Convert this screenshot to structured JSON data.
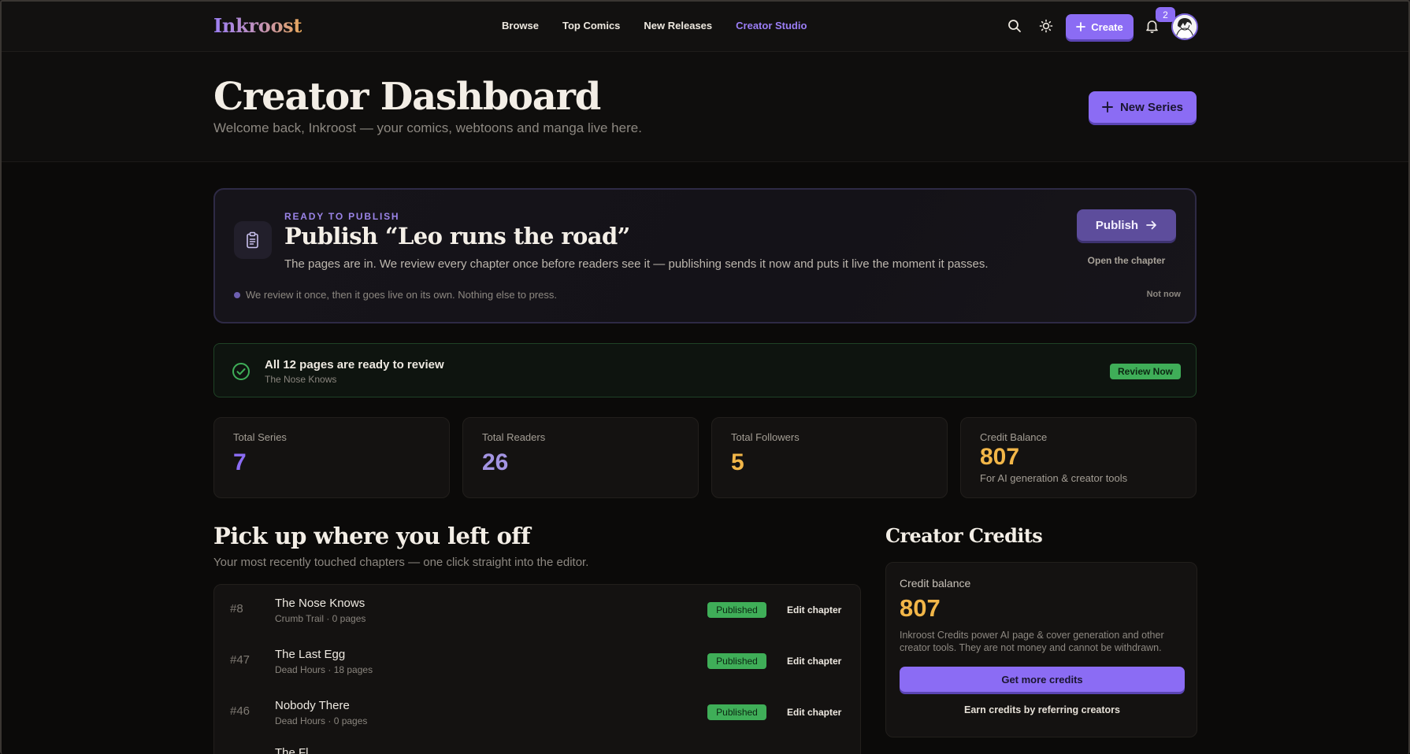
{
  "app": {
    "logo": "Inkroost"
  },
  "nav": {
    "links": [
      "Browse",
      "Top Comics",
      "New Releases",
      "Creator Studio"
    ],
    "active": "Creator Studio",
    "create_label": "Create",
    "notification_count": "2",
    "icons": [
      "search-icon",
      "sun-icon",
      "plus-icon",
      "bell-icon"
    ]
  },
  "header": {
    "title": "Creator Dashboard",
    "subtitle": "Welcome back, Inkroost — your comics, webtoons and manga live here.",
    "new_series_label": "New Series"
  },
  "publish": {
    "eyebrow": "READY TO PUBLISH",
    "title": "Publish “Leo runs the road”",
    "description": "The pages are in. We review every chapter once before readers see it — publishing sends it now and puts it live the moment it passes.",
    "note": "We review it once, then it goes live on its own. Nothing else to press.",
    "publish_label": "Publish",
    "open_label": "Open the chapter",
    "dismiss_label": "Not now"
  },
  "review": {
    "title": "All 12 pages are ready to review",
    "series": "The Nose Knows",
    "button_label": "Review Now"
  },
  "stats": [
    {
      "label": "Total Series",
      "value": "7",
      "color": "#8b6cf4"
    },
    {
      "label": "Total Readers",
      "value": "26",
      "color": "#a394e2"
    },
    {
      "label": "Total Followers",
      "value": "5",
      "color": "#f2b648"
    },
    {
      "label": "Credit Balance",
      "value": "807",
      "color": "#f2b648",
      "sub": "For AI generation & creator tools"
    }
  ],
  "recent": {
    "title": "Pick up where you left off",
    "subtitle": "Your most recently touched chapters — one click straight into the editor.",
    "rows": [
      {
        "num": "#8",
        "title": "The Nose Knows",
        "meta": "Crumb Trail · 0 pages",
        "status": "Published",
        "action": "Edit chapter"
      },
      {
        "num": "#47",
        "title": "The Last Egg",
        "meta": "Dead Hours · 18 pages",
        "status": "Published",
        "action": "Edit chapter"
      },
      {
        "num": "#46",
        "title": "Nobody There",
        "meta": "Dead Hours · 0 pages",
        "status": "Published",
        "action": "Edit chapter"
      },
      {
        "num": "",
        "title": "The Fl",
        "meta": "",
        "status": "",
        "action": ""
      }
    ]
  },
  "credits": {
    "title": "Creator Credits",
    "label": "Credit balance",
    "value": "807",
    "description": "Inkroost Credits power AI page & cover generation and other creator tools. They are not money and cannot be withdrawn.",
    "button_label": "Get more credits",
    "link_label": "Earn credits by referring creators"
  },
  "colors": {
    "accent": "#8b6cf4",
    "gold": "#f2b648",
    "success": "#3fae58",
    "background": "#0b0a09"
  }
}
